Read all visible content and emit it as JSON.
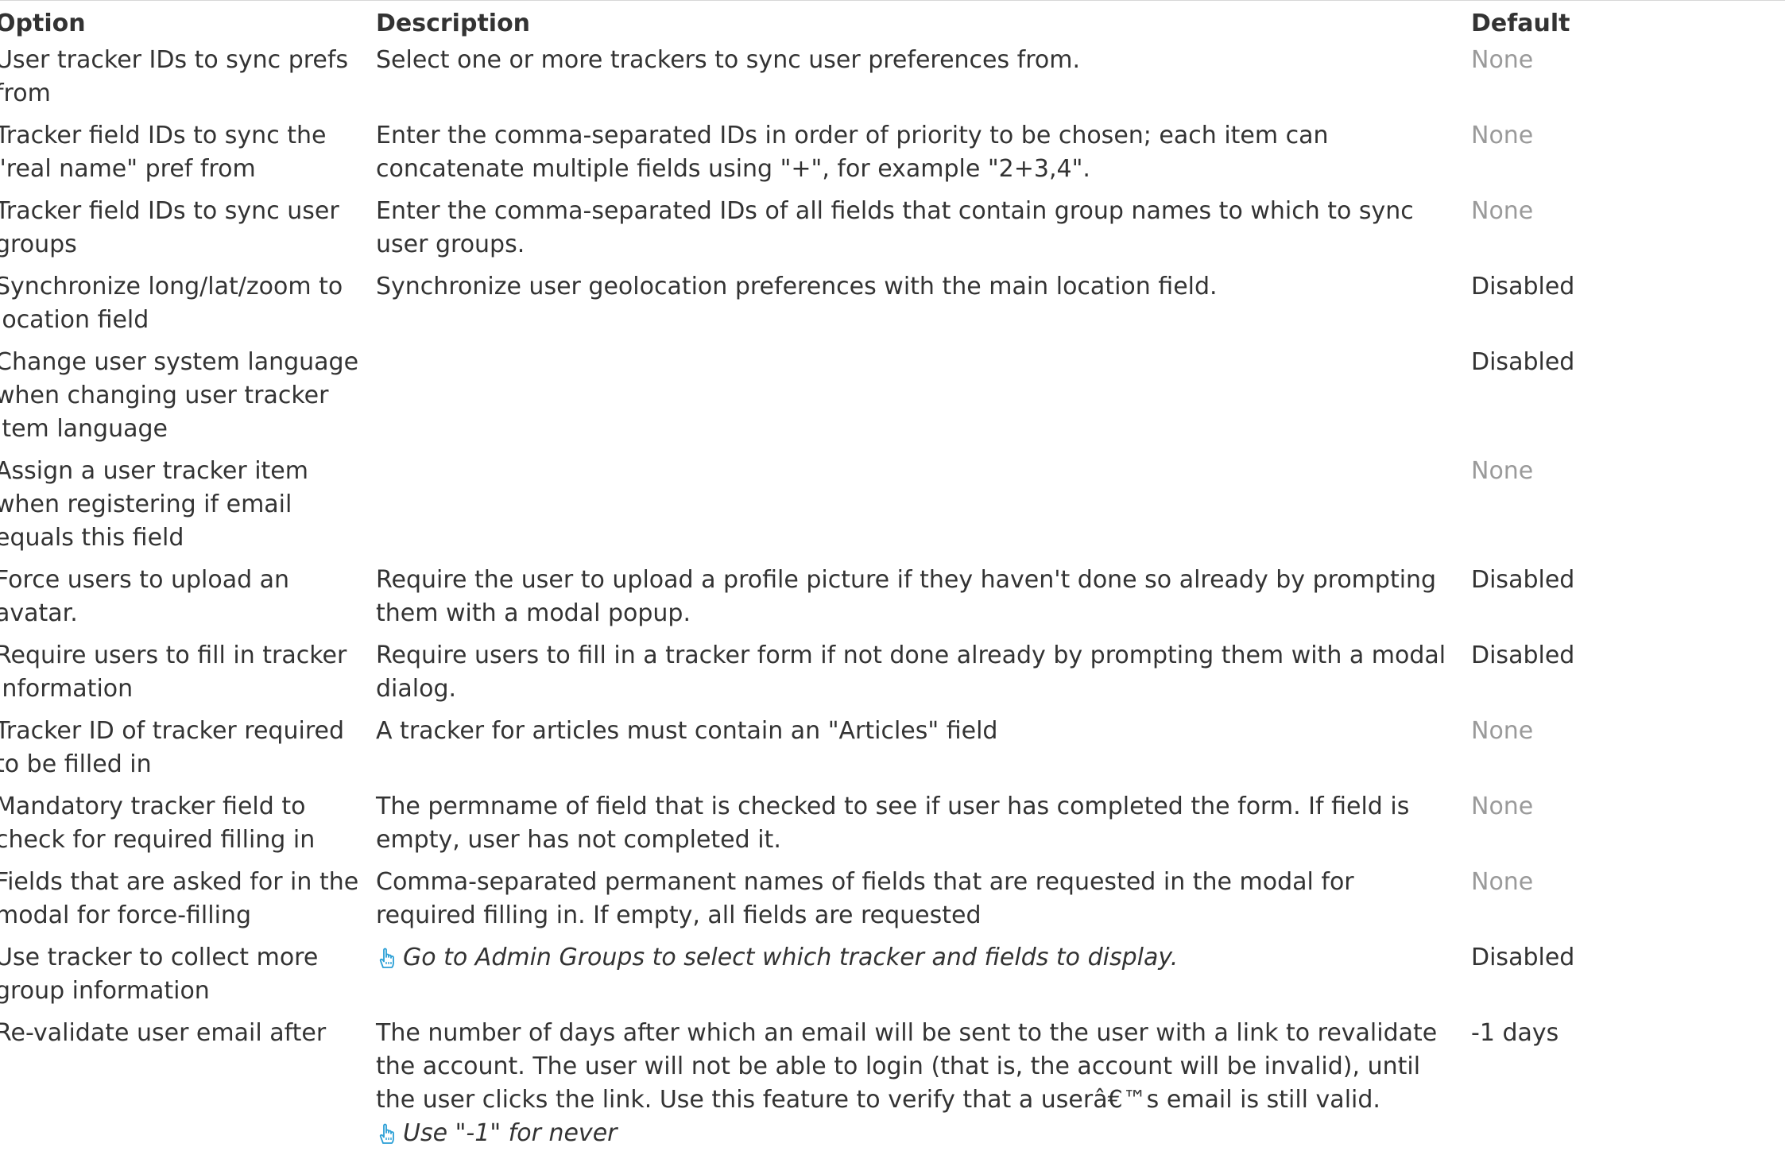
{
  "headers": {
    "option": "Option",
    "description": "Description",
    "default": "Default"
  },
  "rows": [
    {
      "option": "User tracker IDs to sync prefs from",
      "description": "Select one or more trackers to sync user preferences from.",
      "default": "None"
    },
    {
      "option": "Tracker field IDs to sync the \"real name\" pref from",
      "description": "Enter the comma-separated IDs in order of priority to be chosen; each item can concatenate multiple fields using \"+\", for example \"2+3,4\".",
      "default": "None"
    },
    {
      "option": "Tracker field IDs to sync user groups",
      "description": "Enter the comma-separated IDs of all fields that contain group names to which to sync user groups.",
      "default": "None"
    },
    {
      "option": "Synchronize long/lat/zoom to location field",
      "description": "Synchronize user geolocation preferences with the main location field.",
      "default": "Disabled"
    },
    {
      "option": "Change user system language when changing user tracker item language",
      "description": "",
      "default": "Disabled"
    },
    {
      "option": "Assign a user tracker item when registering if email equals this field",
      "description": "",
      "default": "None"
    },
    {
      "option": "Force users to upload an avatar.",
      "description": "Require the user to upload a profile picture if they haven't done so already by prompting them with a modal popup.",
      "default": "Disabled"
    },
    {
      "option": "Require users to fill in tracker information",
      "description": "Require users to fill in a tracker form if not done already by prompting them with a modal dialog.",
      "default": "Disabled"
    },
    {
      "option": "Tracker ID of tracker required to be filled in",
      "description": "A tracker for articles must contain an \"Articles\" field",
      "default": "None"
    },
    {
      "option": "Mandatory tracker field to check for required filling in",
      "description": "The permname of field that is checked to see if user has completed the form. If field is empty, user has not completed it.",
      "default": "None"
    },
    {
      "option": "Fields that are asked for in the modal for force-filling",
      "description": "Comma-separated permanent names of fields that are requested in the modal for required filling in. If empty, all fields are requested",
      "default": "None"
    },
    {
      "option": "Use tracker to collect more group information",
      "hint": "Go to Admin Groups to select which tracker and fields to display.",
      "default": "Disabled"
    },
    {
      "option": "Re-validate user email after",
      "description": "The number of days after which an email will be sent to the user with a link to revalidate the account. The user will not be able to login (that is, the account will be invalid), until the user clicks the link. Use this feature to verify that a userâ€™s email is still valid.",
      "hint_parts": {
        "pre": "Use ",
        "open_quote": "\"",
        "value": "-1",
        "close_quote": "\"",
        "post": " for never"
      },
      "default": "-1 days"
    }
  ],
  "colors": {
    "text": "#333333",
    "default_none": "#9a9a9a",
    "hint_icon": "#2a9fd6",
    "top_border": "#d7d7d7"
  },
  "icons": {
    "hint": "pointing-hand-icon"
  }
}
